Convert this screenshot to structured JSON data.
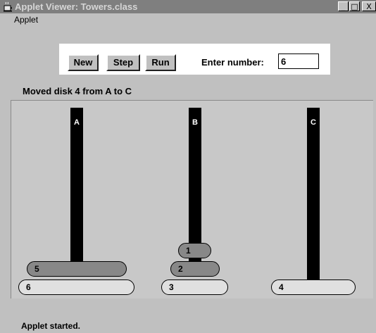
{
  "window": {
    "title": "Applet Viewer: Towers.class",
    "minimize_glyph": "_",
    "maximize_glyph": "□",
    "close_glyph": "X"
  },
  "menu": {
    "items": [
      "Applet"
    ]
  },
  "controls": {
    "new_label": "New",
    "step_label": "Step",
    "run_label": "Run",
    "number_label": "Enter number:",
    "number_value": "6"
  },
  "message": "Moved disk 4 from A to C",
  "towers": {
    "pegs": [
      {
        "label": "A",
        "disks": [
          6,
          5
        ]
      },
      {
        "label": "B",
        "disks": [
          3,
          2,
          1
        ]
      },
      {
        "label": "C",
        "disks": [
          4
        ]
      }
    ],
    "disk_colors": {
      "light": "#e0e0e0",
      "mid": "#b0b0b0",
      "dark": "#888888"
    }
  },
  "status_bar": "Applet started."
}
